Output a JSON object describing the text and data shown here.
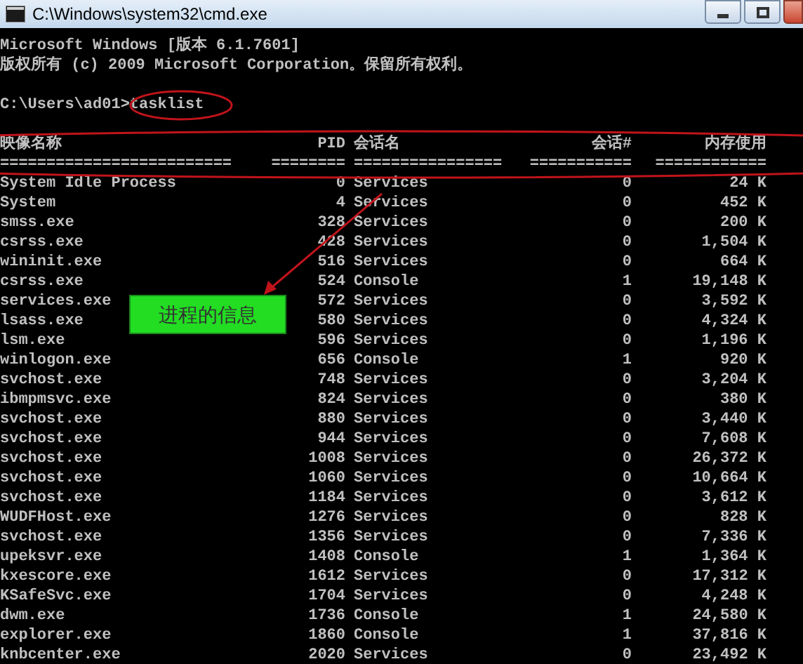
{
  "window": {
    "title": "C:\\Windows\\system32\\cmd.exe"
  },
  "console": {
    "banner": [
      "Microsoft Windows [版本 6.1.7601]",
      "版权所有 (c) 2009 Microsoft Corporation。保留所有权利。"
    ],
    "prompt": "C:\\Users\\ad01>tasklist",
    "columns": [
      "映像名称",
      "PID",
      "会话名",
      "会话#",
      "内存使用"
    ],
    "separators": [
      "=========================",
      "========",
      "================",
      "===========",
      "============"
    ],
    "rows": [
      {
        "name": "System Idle Process",
        "pid": "0",
        "session_name": "Services",
        "session": "0",
        "memory": "24 K"
      },
      {
        "name": "System",
        "pid": "4",
        "session_name": "Services",
        "session": "0",
        "memory": "452 K"
      },
      {
        "name": "smss.exe",
        "pid": "328",
        "session_name": "Services",
        "session": "0",
        "memory": "200 K"
      },
      {
        "name": "csrss.exe",
        "pid": "428",
        "session_name": "Services",
        "session": "0",
        "memory": "1,504 K"
      },
      {
        "name": "wininit.exe",
        "pid": "516",
        "session_name": "Services",
        "session": "0",
        "memory": "664 K"
      },
      {
        "name": "csrss.exe",
        "pid": "524",
        "session_name": "Console",
        "session": "1",
        "memory": "19,148 K"
      },
      {
        "name": "services.exe",
        "pid": "572",
        "session_name": "Services",
        "session": "0",
        "memory": "3,592 K"
      },
      {
        "name": "lsass.exe",
        "pid": "580",
        "session_name": "Services",
        "session": "0",
        "memory": "4,324 K"
      },
      {
        "name": "lsm.exe",
        "pid": "596",
        "session_name": "Services",
        "session": "0",
        "memory": "1,196 K"
      },
      {
        "name": "winlogon.exe",
        "pid": "656",
        "session_name": "Console",
        "session": "1",
        "memory": "920 K"
      },
      {
        "name": "svchost.exe",
        "pid": "748",
        "session_name": "Services",
        "session": "0",
        "memory": "3,204 K"
      },
      {
        "name": "ibmpmsvc.exe",
        "pid": "824",
        "session_name": "Services",
        "session": "0",
        "memory": "380 K"
      },
      {
        "name": "svchost.exe",
        "pid": "880",
        "session_name": "Services",
        "session": "0",
        "memory": "3,440 K"
      },
      {
        "name": "svchost.exe",
        "pid": "944",
        "session_name": "Services",
        "session": "0",
        "memory": "7,608 K"
      },
      {
        "name": "svchost.exe",
        "pid": "1008",
        "session_name": "Services",
        "session": "0",
        "memory": "26,372 K"
      },
      {
        "name": "svchost.exe",
        "pid": "1060",
        "session_name": "Services",
        "session": "0",
        "memory": "10,664 K"
      },
      {
        "name": "svchost.exe",
        "pid": "1184",
        "session_name": "Services",
        "session": "0",
        "memory": "3,612 K"
      },
      {
        "name": "WUDFHost.exe",
        "pid": "1276",
        "session_name": "Services",
        "session": "0",
        "memory": "828 K"
      },
      {
        "name": "svchost.exe",
        "pid": "1356",
        "session_name": "Services",
        "session": "0",
        "memory": "7,336 K"
      },
      {
        "name": "upeksvr.exe",
        "pid": "1408",
        "session_name": "Console",
        "session": "1",
        "memory": "1,364 K"
      },
      {
        "name": "kxescore.exe",
        "pid": "1612",
        "session_name": "Services",
        "session": "0",
        "memory": "17,312 K"
      },
      {
        "name": "KSafeSvc.exe",
        "pid": "1704",
        "session_name": "Services",
        "session": "0",
        "memory": "4,248 K"
      },
      {
        "name": "dwm.exe",
        "pid": "1736",
        "session_name": "Console",
        "session": "1",
        "memory": "24,580 K"
      },
      {
        "name": "explorer.exe",
        "pid": "1860",
        "session_name": "Console",
        "session": "1",
        "memory": "37,816 K"
      },
      {
        "name": "knbcenter.exe",
        "pid": "2020",
        "session_name": "Services",
        "session": "0",
        "memory": "23,492 K"
      }
    ]
  },
  "annotation": {
    "label": "进程的信息"
  }
}
